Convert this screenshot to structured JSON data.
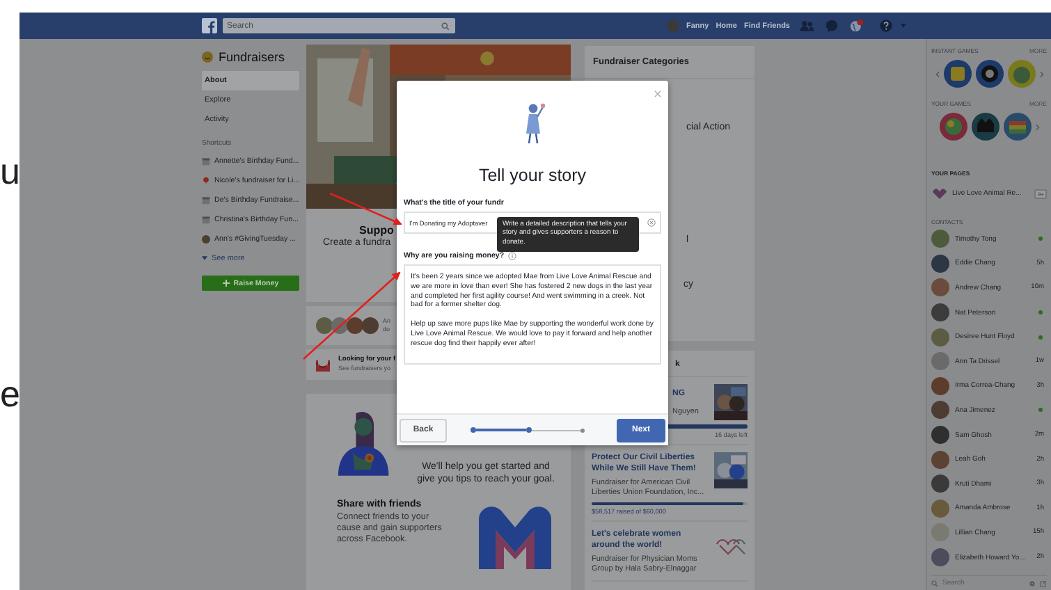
{
  "edge_letters": [
    "u",
    "e"
  ],
  "top_bar": {
    "search": {
      "placeholder": "Search"
    },
    "profile_name": "Fanny",
    "links": [
      "Home",
      "Find Friends"
    ]
  },
  "sidebar": {
    "title": "Fundraisers",
    "nav": [
      {
        "label": "About",
        "selected": true
      },
      {
        "label": "Explore",
        "selected": false
      },
      {
        "label": "Activity",
        "selected": false
      }
    ],
    "shortcuts_heading": "Shortcuts",
    "shortcuts": [
      {
        "label": "Annette's Birthday Fund...",
        "kind": "calendar"
      },
      {
        "label": "Nicole's fundraiser for Li...",
        "kind": "pin"
      },
      {
        "label": "De's Birthday Fundraise...",
        "kind": "calendar"
      },
      {
        "label": "Christina's Birthday Fun...",
        "kind": "calendar"
      },
      {
        "label": "Ann's #GivingTuesday ..."
      }
    ],
    "see_more": "See more",
    "raise_button": "Raise Money"
  },
  "center": {
    "cover": {
      "kind": "picture",
      "title": "Suppo",
      "subtitle": "Create a fundra"
    },
    "supporters_caption": [
      "An",
      "do"
    ],
    "looking_card": {
      "title": "Looking for your f",
      "subtitle": "See fundraisers yo"
    },
    "help_text": "We'll help you get started and give you tips to reach your goal.",
    "share": {
      "title": "Share with friends",
      "text": "Connect friends to your cause and gain supporters across Facebook."
    }
  },
  "categories": {
    "title": "Fundraiser Categories",
    "fragments": [
      "cial Action",
      "l",
      "cy"
    ]
  },
  "fundraisers": {
    "header_fragment": "k",
    "items": [
      {
        "title": "NG",
        "subtitle": "Nguyen",
        "level": 1,
        "time_left": "16 days left"
      },
      {
        "title": "Protect Our Civil Liberties While We Still Have Them!",
        "subtitle": "Fundraiser for American Civil Liberties Union Foundation, Inc...",
        "level": 0.97,
        "amount_raised": "$58,517 raised of $60,000"
      },
      {
        "title": "Let's celebrate women around the world!",
        "subtitle": "Fundraiser for Physician Moms Group by Hala Sabry-Elnaggar",
        "kind": "logo"
      }
    ]
  },
  "modal": {
    "title": "Tell your story",
    "title_field": {
      "label": "What's the title of your fundr",
      "value": "I'm Donating my Adoptaver"
    },
    "tooltip": "Write a detailed description that tells your story and gives supporters a reason to donate.",
    "story_field": {
      "label": "Why are you raising money?",
      "value": [
        "It's been 2 years since we adopted Mae from Live Love Animal Rescue and we are more in love than ever! She has fostered 2 new dogs in the last year and completed her first agility course! And went swimming in a creek. Not bad for a former shelter dog.",
        "Help up save more pups like Mae by supporting the wonderful work done by Live Love Animal Rescue. We would love to pay it forward and help another rescue dog find their happily ever after!"
      ]
    },
    "back_button": "Back",
    "next_button": "Next",
    "steps": [
      {
        "completed": true
      },
      {
        "completed": true
      },
      {
        "completed": false
      }
    ]
  },
  "chat": {
    "instant_games": {
      "heading": "INSTANT GAMES",
      "more": "MORE"
    },
    "your_games": {
      "heading": "YOUR GAMES",
      "more": "MORE"
    },
    "pages_heading": "YOUR PAGES",
    "page": {
      "name": "Live Love Animal Re...",
      "badge": "9+"
    },
    "contacts_heading": "CONTACTS",
    "contacts": [
      {
        "name": "Timothy Tong",
        "online": true
      },
      {
        "name": "Eddie Chang",
        "online": false,
        "last_seen": "5h"
      },
      {
        "name": "Andrew Chang",
        "online": false,
        "last_seen": "10m"
      },
      {
        "name": "Nat Peterson",
        "online": true
      },
      {
        "name": "Desiree Hunt Floyd",
        "online": true
      },
      {
        "name": "Ann Ta Drissel",
        "online": false,
        "last_seen": "1w"
      },
      {
        "name": "Irma Correa-Chang",
        "online": false,
        "last_seen": "3h"
      },
      {
        "name": "Ana Jimenez",
        "online": true
      },
      {
        "name": "Sam Ghosh",
        "online": false,
        "last_seen": "2m"
      },
      {
        "name": "Leah Goh",
        "online": false,
        "last_seen": "2h"
      },
      {
        "name": "Kruti Dhami",
        "online": false,
        "last_seen": "3h"
      },
      {
        "name": "Amanda Ambrose",
        "online": false,
        "last_seen": "1h"
      },
      {
        "name": "Lillian Chang",
        "online": false,
        "last_seen": "15h"
      },
      {
        "name": "Elizabeth Howard Yo...",
        "online": false,
        "last_seen": "2h"
      }
    ],
    "search": {
      "placeholder": "Search"
    }
  }
}
